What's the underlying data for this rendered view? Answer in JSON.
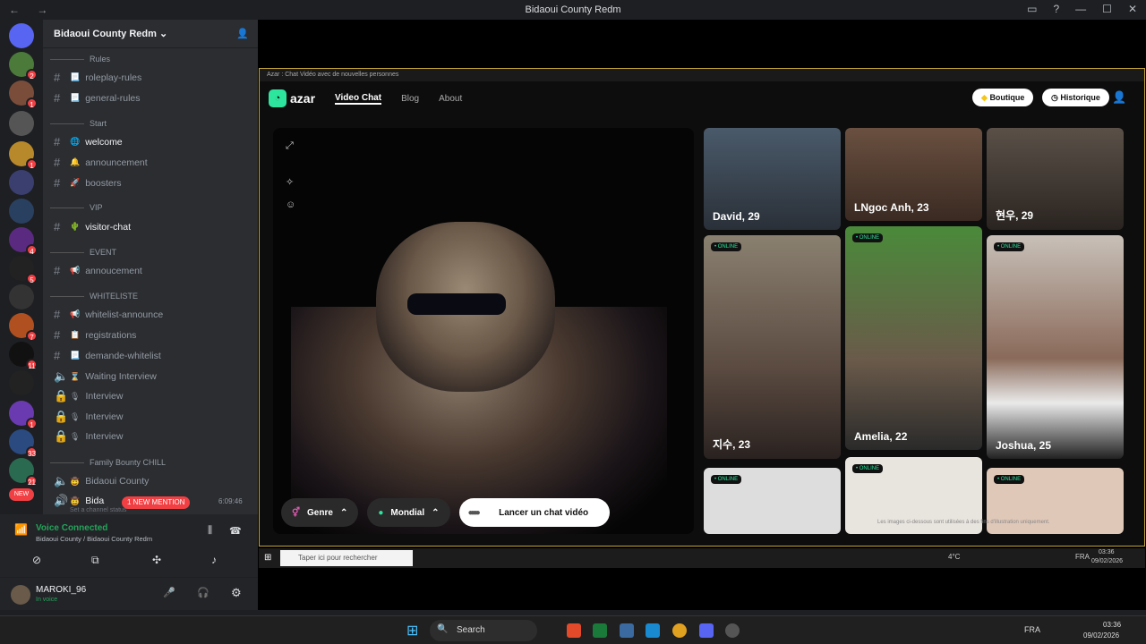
{
  "window": {
    "title": "Bidaoui County Redm"
  },
  "guild": {
    "name": "Bidaoui County Redm"
  },
  "categories": [
    "Rules",
    "Start",
    "VIP",
    "EVENT",
    "WHITELISTE",
    "Family Bounty CHILL"
  ],
  "channels": {
    "c1": "roleplay-rules",
    "c2": "general-rules",
    "c3": "welcome",
    "c4": "announcement",
    "c5": "boosters",
    "c6": "visitor-chat",
    "c7": "annoucement",
    "c8": "whitelist-announce",
    "c9": "registrations",
    "c10": "demande-whitelist",
    "c11": "Waiting Interview",
    "c12": "Interview",
    "c13": "Interview",
    "c14": "Interview",
    "c15": "Bidaoui County",
    "c16": "Bida"
  },
  "voice": {
    "timer": "6:09:46",
    "mention": "1 NEW MENTION",
    "status_placeholder": "Set a channel status",
    "connected": "Voice Connected",
    "location": "Bidaoui County / Bidaoui County Redm"
  },
  "user": {
    "name": "MAROKI_96",
    "status": "In voice"
  },
  "server_badges": [
    "2",
    "1",
    "1",
    "4",
    "5",
    "7",
    "11",
    "1",
    "33",
    "21",
    "NEW"
  ],
  "azar": {
    "tab_title": "Azar : Chat Vidéo avec de nouvelles personnes",
    "logo": "azar",
    "nav": [
      "Video Chat",
      "Blog",
      "About"
    ],
    "boutique": "Boutique",
    "historique": "Historique",
    "genre": "Genre",
    "mondial": "Mondial",
    "start": "Lancer un chat vidéo",
    "online": "• ONLINE",
    "cards": {
      "a": "David, 29",
      "b": "LNgoc Anh, 23",
      "c": "현우, 29",
      "d": "지수, 23",
      "e": "Amelia, 22",
      "f": "Joshua, 25"
    },
    "disclaimer": "Les images ci-dessous sont utilisées à des fins d'illustration uniquement."
  },
  "inner_taskbar": {
    "search": "Taper ici pour rechercher",
    "temp": "4°C",
    "lang": "FRA",
    "time": "03:36",
    "date": "09/02/2026"
  },
  "taskbar": {
    "search": "Search",
    "lang": "FRA",
    "time": "03:36",
    "date": "09/02/2026"
  }
}
